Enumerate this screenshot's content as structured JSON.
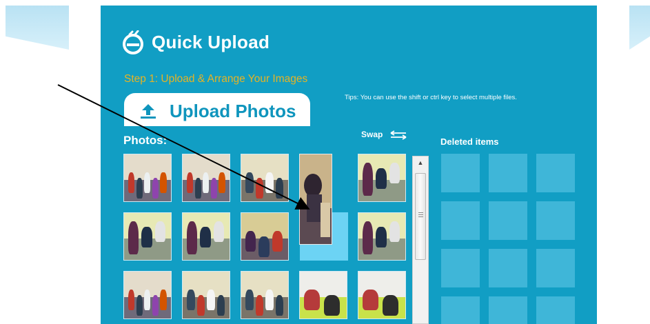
{
  "app": {
    "title": "Quick Upload",
    "logo_icon": "e-logo-icon",
    "colors": {
      "panel": "#119ec4",
      "step_text": "#e6b324",
      "upload_text": "#0f95bd",
      "drop_target": "#6cd3f4",
      "deleted_slot": "#3fb6d8"
    }
  },
  "step": {
    "label": "Step 1: Upload & Arrange Your Images"
  },
  "tips": {
    "text": "Tips: You can use the shift or ctrl key to select multiple files."
  },
  "upload": {
    "label": "Upload Photos",
    "icon": "upload-arrow-icon"
  },
  "photos": {
    "label": "Photos:",
    "swap_label": "Swap",
    "swap_icon": "swap-arrows-icon",
    "grid": [
      {
        "kind": "classroom-group"
      },
      {
        "kind": "classroom-group"
      },
      {
        "kind": "classroom-seated"
      },
      {
        "kind": "dragging"
      },
      {
        "kind": "teacher-standing"
      },
      {
        "kind": "teacher-standing"
      },
      {
        "kind": "teacher-standing"
      },
      {
        "kind": "teacher-seated"
      },
      {
        "kind": "drop-target"
      },
      {
        "kind": "teacher-standing"
      },
      {
        "kind": "classroom-group"
      },
      {
        "kind": "classroom-seated"
      },
      {
        "kind": "classroom-seated"
      },
      {
        "kind": "child-wall"
      },
      {
        "kind": "child-wall"
      }
    ]
  },
  "deleted": {
    "label": "Deleted items",
    "slot_count": 12
  },
  "scroll": {
    "up_icon": "scroll-up-icon"
  }
}
